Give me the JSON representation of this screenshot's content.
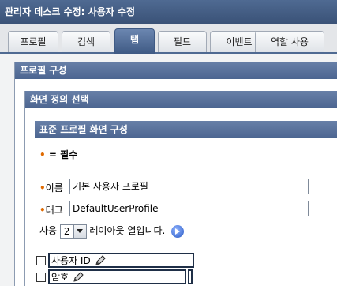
{
  "window": {
    "title": "관리자 데스크 수정: 사용자 수정"
  },
  "tabs": [
    {
      "label": "프로필"
    },
    {
      "label": "검색"
    },
    {
      "label": "탭",
      "active": true
    },
    {
      "label": "필드"
    },
    {
      "label": "이벤트"
    },
    {
      "label": "역할 사용"
    }
  ],
  "sections": {
    "profile_config": "프로필 구성",
    "screen_def": "화면 정의 선택",
    "standard_profile": "표준 프로필 화면 구성"
  },
  "required_note": "= 필수",
  "fields": {
    "name": {
      "label": "이름",
      "value": "기본 사용자 프로필"
    },
    "tag": {
      "label": "태그",
      "value": "DefaultUserProfile"
    }
  },
  "layout_row": {
    "prefix": "사용",
    "columns": "2",
    "suffix": "레이아웃 열입니다."
  },
  "items": [
    {
      "label": "사용자 ID"
    },
    {
      "label": "암호"
    }
  ],
  "colors": {
    "accent": "#4f6a92",
    "required_dot": "#e06a00"
  }
}
